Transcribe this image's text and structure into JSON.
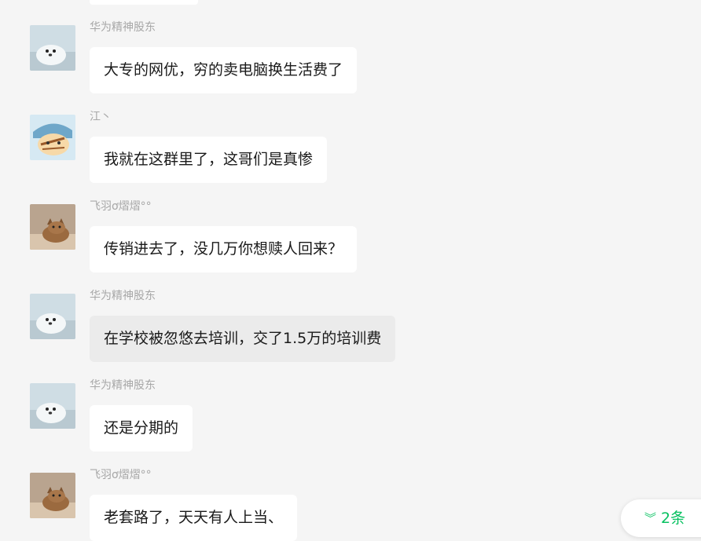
{
  "messages": [
    {
      "sender": "华为精神股东",
      "text": "大专的网优，穷的卖电脑换生活费了",
      "avatar": "seal-icon",
      "highlight": false
    },
    {
      "sender": "江丶",
      "text": "我就在这群里了，这哥们是真惨",
      "avatar": "cartoon-icon",
      "highlight": false
    },
    {
      "sender": "飞羽ơ熠熠°°",
      "text": "传销进去了，没几万你想赎人回来？",
      "avatar": "kitten-icon",
      "highlight": false
    },
    {
      "sender": "华为精神股东",
      "text": "在学校被忽悠去培训，交了1.5万的培训费",
      "avatar": "seal-icon",
      "highlight": true
    },
    {
      "sender": "华为精神股东",
      "text": "还是分期的",
      "avatar": "seal-icon",
      "highlight": false
    },
    {
      "sender": "飞羽ơ熠熠°°",
      "text": "老套路了，天天有人上当、",
      "avatar": "kitten-icon",
      "highlight": false
    }
  ],
  "new_messages_button": {
    "label": "2条",
    "icon": "chevron-double-down-icon"
  },
  "colors": {
    "accent": "#07c160",
    "background": "#f5f5f5",
    "bubble": "#ffffff",
    "bubble_highlight": "#ebebeb",
    "sender": "#a7a7a7"
  }
}
